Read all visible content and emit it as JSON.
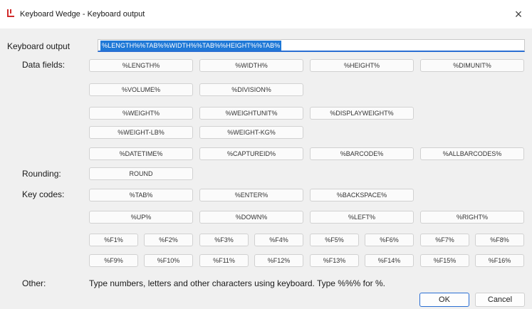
{
  "window": {
    "title": "Keyboard Wedge - Keyboard output",
    "close_glyph": "×",
    "icon": "app-logo-icon",
    "icon_color": "#d12a2a"
  },
  "labels": {
    "keyboard_output": "Keyboard output",
    "data_fields": "Data fields:",
    "rounding": "Rounding:",
    "key_codes": "Key codes:",
    "other": "Other:",
    "other_text": "Type numbers, letters and other characters using keyboard. Type %%% for %."
  },
  "keyboard_output": {
    "value": "%LENGTH%%TAB%%WIDTH%%TAB%%HEIGHT%%TAB%"
  },
  "data_fields": [
    [
      "%LENGTH%",
      "%WIDTH%",
      "%HEIGHT%",
      "%DIMUNIT%"
    ],
    [
      "%VOLUME%",
      "%DIVISION%"
    ],
    [
      "%WEIGHT%",
      "%WEIGHTUNIT%",
      "%DISPLAYWEIGHT%"
    ],
    [
      "%WEIGHT-LB%",
      "%WEIGHT-KG%"
    ],
    [
      "%DATETIME%",
      "%CAPTUREID%",
      "%BARCODE%",
      "%ALLBARCODES%"
    ]
  ],
  "rounding": [
    "ROUND"
  ],
  "key_codes": [
    [
      "%TAB%",
      "%ENTER%",
      "%BACKSPACE%"
    ],
    [
      "%UP%",
      "%DOWN%",
      "%LEFT%",
      "%RIGHT%"
    ]
  ],
  "function_keys": [
    [
      "%F1%",
      "%F2%",
      "%F3%",
      "%F4%",
      "%F5%",
      "%F6%",
      "%F7%",
      "%F8%"
    ],
    [
      "%F9%",
      "%F10%",
      "%F11%",
      "%F12%",
      "%F13%",
      "%F14%",
      "%F15%",
      "%F16%"
    ]
  ],
  "buttons": {
    "ok": "OK",
    "cancel": "Cancel"
  },
  "colors": {
    "accent": "#1e78d7",
    "selection_text": "#ffffff",
    "logo_red": "#d12a2a"
  }
}
